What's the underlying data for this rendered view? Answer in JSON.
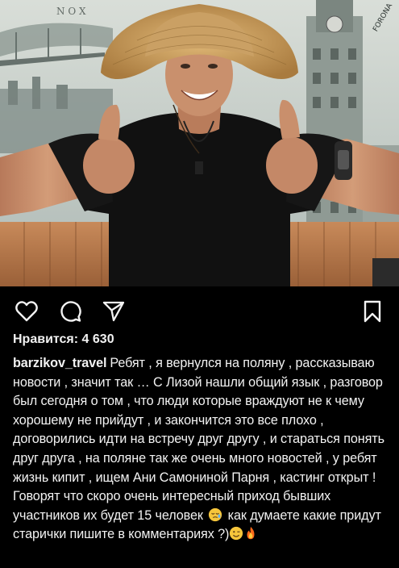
{
  "post": {
    "likes_label": "Нравится:",
    "likes_count": "4 630",
    "username": "barzikov_travel",
    "caption_text": "Ребят , я вернулся на поляну , рассказываю новости , значит так … С Лизой нашли общий язык , разговор был сегодня о том , что люди которые враждуют не к чему хорошему не прийдут , и закончится это все плохо , договорились идти на встречу друг другу , и стараться понять друг друга , на поляне так же очень много новостей , у ребят жизнь кипит , ищем Ани Самониной Парня , кастинг открыт ! Говорят что скоро очень интересный приход бывших участников их будет 15 человек",
    "caption_text_2": "как думаете какие придут старички пишите в комментариях ?)",
    "photo_sign_text": "FORONA"
  },
  "icons": {
    "like": "heart-outline-icon",
    "comment": "speech-bubble-icon",
    "share": "paper-plane-icon",
    "save": "bookmark-icon",
    "emoji_1": "sleepy-face-emoji",
    "emoji_2": "winking-face-emoji",
    "emoji_3": "fire-emoji"
  },
  "colors": {
    "background": "#000000",
    "text": "#f2f2f2",
    "shirt": "#111111",
    "hat": "#c8a064",
    "skin": "#c98f6c"
  }
}
